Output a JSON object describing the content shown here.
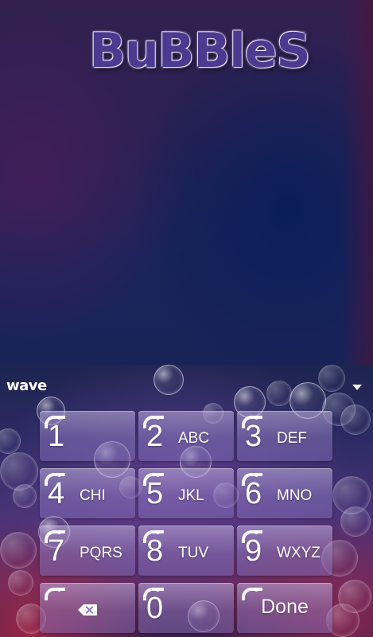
{
  "header": {
    "logo_text": "BuBBleS"
  },
  "keyboard": {
    "brand": "wave",
    "collapse_icon": "chevron-down-icon",
    "keys": {
      "k1": {
        "num": "1",
        "letters": ""
      },
      "k2": {
        "num": "2",
        "letters": "ABC"
      },
      "k3": {
        "num": "3",
        "letters": "DEF"
      },
      "k4": {
        "num": "4",
        "letters": "CHI"
      },
      "k5": {
        "num": "5",
        "letters": "JKL"
      },
      "k6": {
        "num": "6",
        "letters": "MNO"
      },
      "k7": {
        "num": "7",
        "letters": "PQRS"
      },
      "k8": {
        "num": "8",
        "letters": "TUV"
      },
      "k9": {
        "num": "9",
        "letters": "WXYZ"
      },
      "k0": {
        "num": "0",
        "letters": ""
      },
      "backspace_icon": "backspace-icon",
      "done_label": "Done"
    }
  }
}
